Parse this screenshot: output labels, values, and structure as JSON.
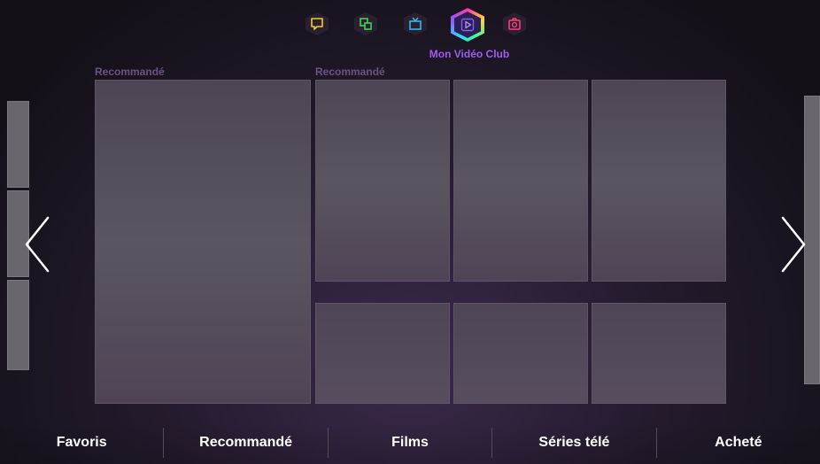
{
  "hub": {
    "title": "Mon Vidéo Club",
    "icons": [
      "chat-icon",
      "multiscreen-icon",
      "tv-icon",
      "play-icon",
      "camera-icon"
    ],
    "active_icon": "play-icon",
    "colors": {
      "chat": "#f0d020",
      "multiscreen": "#40d060",
      "tv": "#30b8f0",
      "play": "#8a5cff",
      "camera": "#ff3c7a",
      "title": "#a05cf0"
    }
  },
  "sections": [
    {
      "label": "Recommandé"
    },
    {
      "label": "Recommandé"
    }
  ],
  "bottom_menu": [
    "Favoris",
    "Recommandé",
    "Films",
    "Séries télé",
    "Acheté"
  ]
}
